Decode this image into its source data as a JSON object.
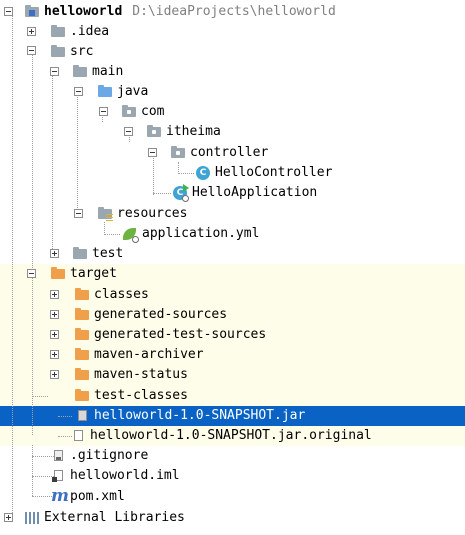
{
  "project": {
    "name": "helloworld",
    "path": "D:\\ideaProjects\\helloworld"
  },
  "nodes": {
    "idea": ".idea",
    "src": "src",
    "main": "main",
    "java": "java",
    "com": "com",
    "itheima": "itheima",
    "controller": "controller",
    "hello_controller": "HelloController",
    "hello_application": "HelloApplication",
    "resources": "resources",
    "application_yml": "application.yml",
    "test": "test",
    "target": "target",
    "classes": "classes",
    "generated_sources": "generated-sources",
    "generated_test_sources": "generated-test-sources",
    "maven_archiver": "maven-archiver",
    "maven_status": "maven-status",
    "test_classes": "test-classes",
    "jar": "helloworld-1.0-SNAPSHOT.jar",
    "jar_original": "helloworld-1.0-SNAPSHOT.jar.original",
    "gitignore": ".gitignore",
    "iml": "helloworld.iml",
    "pom": "pom.xml",
    "external_libraries": "External Libraries"
  },
  "icons": {
    "class_letter": "C",
    "maven_letter": "m"
  },
  "colors": {
    "selection": "#0a63c4",
    "excluded_background": "#fefde9",
    "excluded_folder": "#f0a04b",
    "source_folder": "#6aa9e6",
    "plain_folder": "#9aa7b0",
    "class_icon": "#3fa4d3"
  }
}
